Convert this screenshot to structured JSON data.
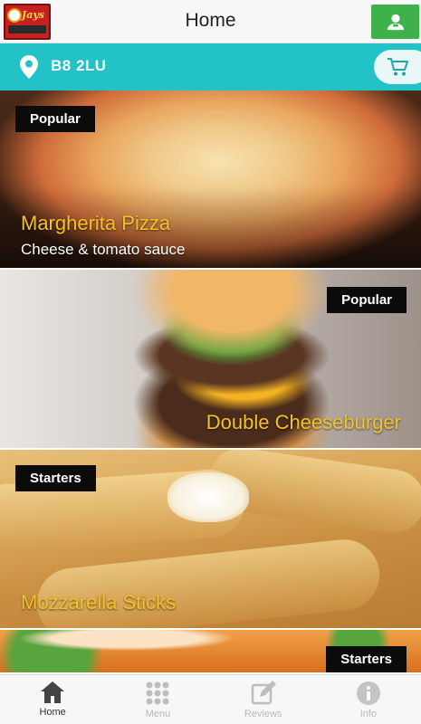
{
  "header": {
    "title": "Home",
    "logo_text": "Jays"
  },
  "location": {
    "postcode": "B8 2LU"
  },
  "cards": [
    {
      "tag": "Popular",
      "name": "Margherita Pizza",
      "description": "Cheese & tomato sauce"
    },
    {
      "tag": "Popular",
      "name": "Double Cheeseburger"
    },
    {
      "tag": "Starters",
      "name": "Mozzarella Sticks"
    },
    {
      "tag": "Starters"
    }
  ],
  "nav": [
    {
      "label": "Home",
      "icon": "home-icon",
      "active": true
    },
    {
      "label": "Menu",
      "icon": "grid-icon",
      "active": false
    },
    {
      "label": "Reviews",
      "icon": "edit-icon",
      "active": false
    },
    {
      "label": "Info",
      "icon": "info-icon",
      "active": false
    }
  ],
  "colors": {
    "location_bar": "#23c2c6",
    "account_button": "#3fb14a",
    "item_name": "#f4c227",
    "tag_bg": "#0b0b0b"
  }
}
